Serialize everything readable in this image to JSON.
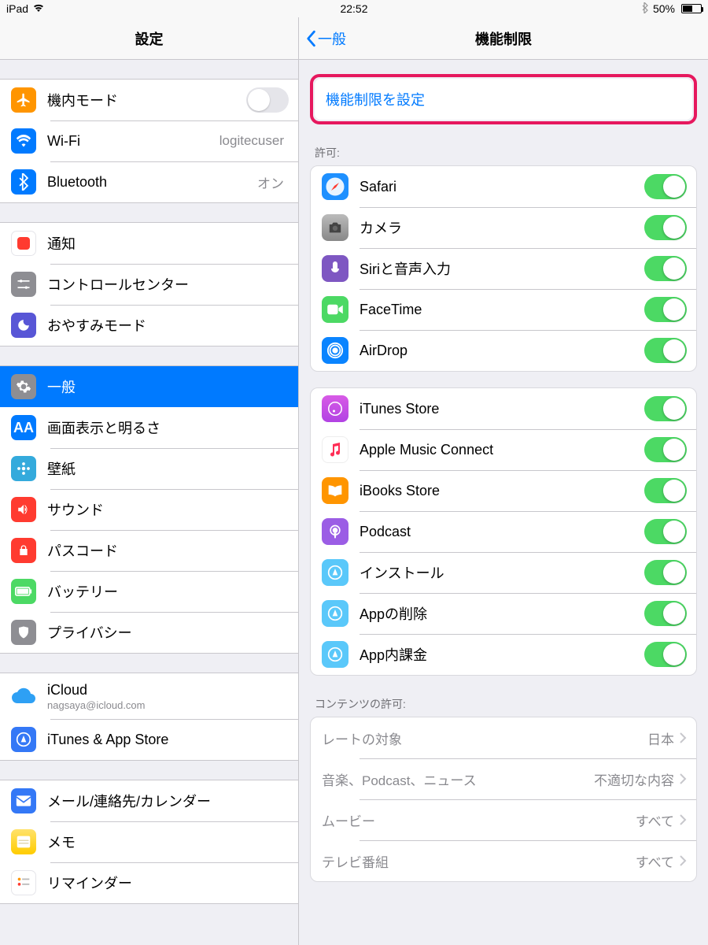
{
  "statusbar": {
    "device": "iPad",
    "time": "22:52",
    "battery_pct": "50%"
  },
  "sidebar": {
    "title": "設定",
    "g1": {
      "airplane": "機内モード",
      "wifi": "Wi-Fi",
      "wifi_val": "logitecuser",
      "bt": "Bluetooth",
      "bt_val": "オン"
    },
    "g2": {
      "notify": "通知",
      "control": "コントロールセンター",
      "dnd": "おやすみモード"
    },
    "g3": {
      "general": "一般",
      "display": "画面表示と明るさ",
      "wallpaper": "壁紙",
      "sound": "サウンド",
      "passcode": "パスコード",
      "battery": "バッテリー",
      "privacy": "プライバシー"
    },
    "g4": {
      "icloud": "iCloud",
      "icloud_sub": "nagsaya@icloud.com",
      "itunes": "iTunes & App Store"
    },
    "g5": {
      "mail": "メール/連絡先/カレンダー",
      "notes": "メモ",
      "reminders": "リマインダー"
    }
  },
  "detail": {
    "back_label": "一般",
    "title": "機能制限",
    "enable_label": "機能制限を設定",
    "allow_header": "許可:",
    "allow": {
      "safari": "Safari",
      "camera": "カメラ",
      "siri": "Siriと音声入力",
      "facetime": "FaceTime",
      "airdrop": "AirDrop"
    },
    "allow2": {
      "itunes": "iTunes Store",
      "amc": "Apple Music Connect",
      "ibooks": "iBooks Store",
      "podcast": "Podcast",
      "install": "インストール",
      "delete": "Appの削除",
      "iap": "App内課金"
    },
    "content_header": "コンテンツの許可:",
    "content": {
      "ratings": {
        "label": "レートの対象",
        "value": "日本"
      },
      "music": {
        "label": "音楽、Podcast、ニュース",
        "value": "不適切な内容"
      },
      "movies": {
        "label": "ムービー",
        "value": "すべて"
      },
      "tv": {
        "label": "テレビ番組",
        "value": "すべて"
      }
    }
  }
}
